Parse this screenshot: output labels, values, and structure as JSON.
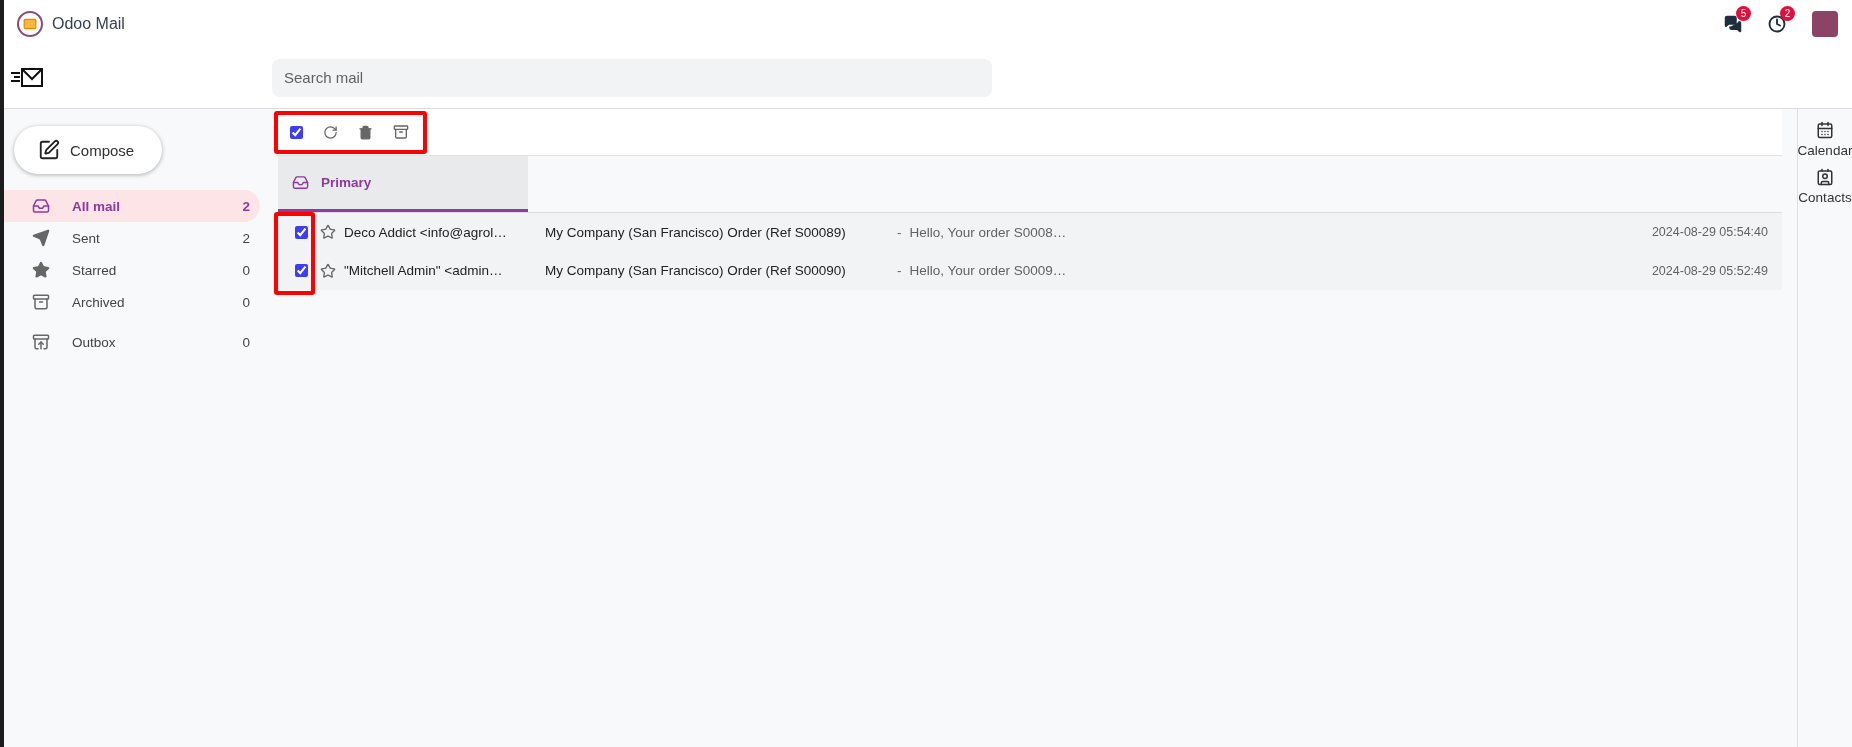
{
  "app": {
    "title": "Odoo Mail"
  },
  "systray": [
    {
      "kind": "chat",
      "badge": "5"
    },
    {
      "kind": "activity",
      "badge": "2"
    }
  ],
  "search": {
    "placeholder": "Search mail"
  },
  "sidebar": {
    "compose": "Compose",
    "sections": [
      {
        "items": [
          {
            "kind": "inbox",
            "label": "All mail",
            "count": "2",
            "selected": true
          },
          {
            "kind": "sent",
            "label": "Sent",
            "count": "2",
            "selected": false
          },
          {
            "kind": "starred",
            "label": "Starred",
            "count": "0",
            "selected": false
          },
          {
            "kind": "archived",
            "label": "Archived",
            "count": "0",
            "selected": false
          }
        ]
      },
      {
        "items": [
          {
            "kind": "outbox",
            "label": "Outbox",
            "count": "0",
            "selected": false
          }
        ]
      }
    ]
  },
  "toolbar": {
    "select_all": {
      "checked": true
    }
  },
  "tabs": [
    {
      "label": "Primary",
      "selected": true
    }
  ],
  "messages": [
    {
      "checked": true,
      "starred": false,
      "sender": "Deco Addict <info@agrol…",
      "subject": "My Company (San Francisco) Order (Ref S00089)",
      "separator": "-",
      "snippet": "Hello, Your order S0008…",
      "date": "2024-08-29 05:54:40"
    },
    {
      "checked": true,
      "starred": false,
      "sender": "\"Mitchell Admin\" <admin…",
      "subject": "My Company (San Francisco) Order (Ref S00090)",
      "separator": "-",
      "snippet": "Hello, Your order S0009…",
      "date": "2024-08-29 05:52:49"
    }
  ],
  "side_apps": [
    {
      "kind": "calendar",
      "label": "Calendar"
    },
    {
      "kind": "contacts",
      "label": "Contacts"
    }
  ]
}
